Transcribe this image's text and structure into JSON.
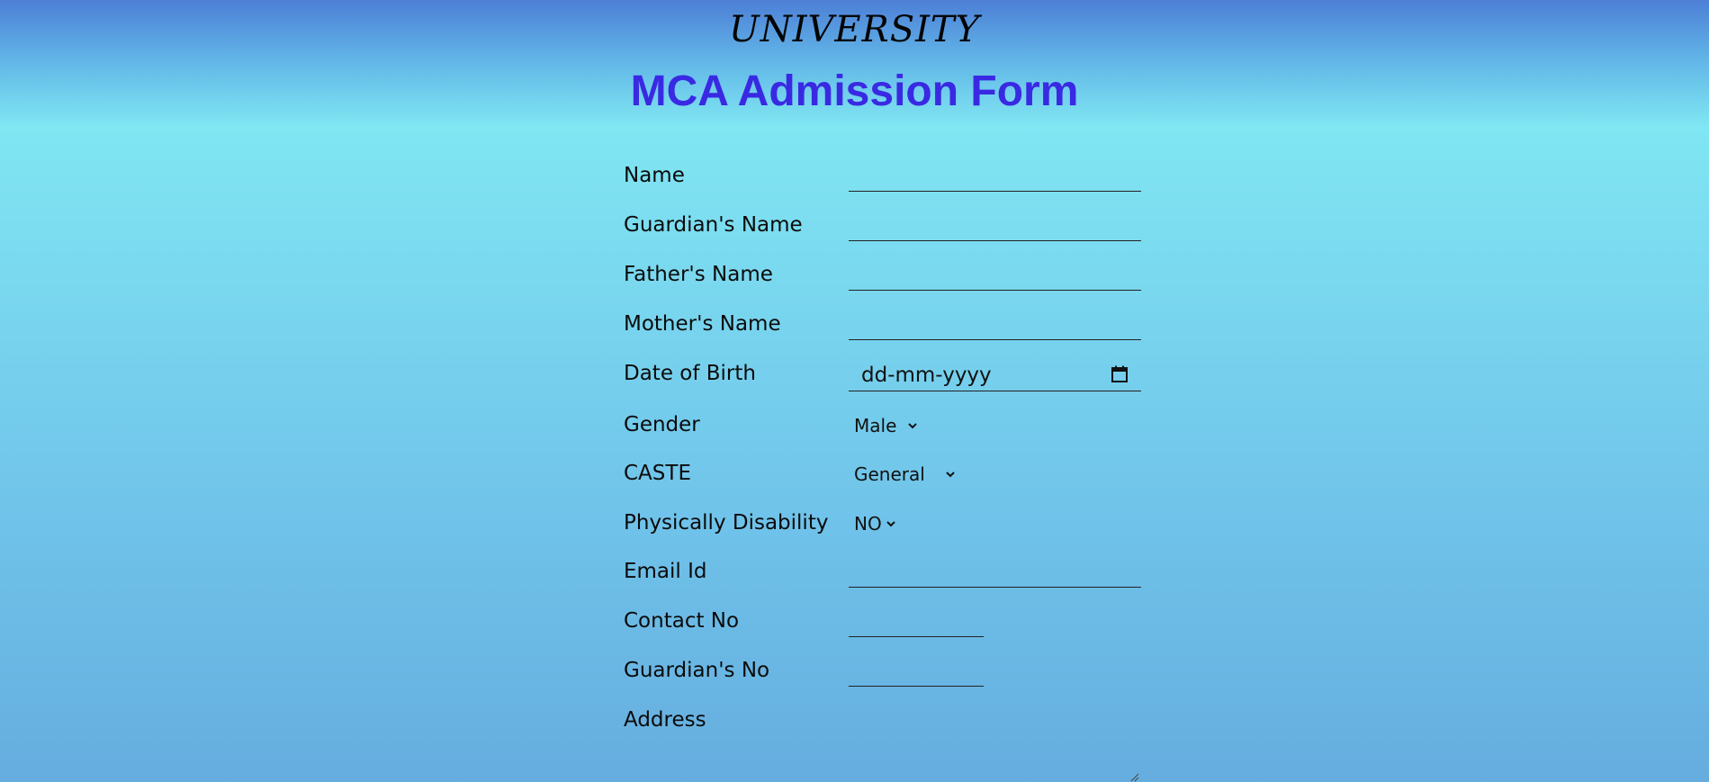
{
  "header": {
    "university": "UNIVERSITY",
    "form_title": "MCA Admission Form"
  },
  "form": {
    "name": {
      "label": "Name",
      "value": ""
    },
    "guardian_name": {
      "label": "Guardian's Name",
      "value": ""
    },
    "father_name": {
      "label": "Father's Name",
      "value": ""
    },
    "mother_name": {
      "label": "Mother's Name",
      "value": ""
    },
    "dob": {
      "label": "Date of Birth",
      "placeholder": "dd-mm-yyyy",
      "icon": "calendar-icon"
    },
    "gender": {
      "label": "Gender",
      "selected": "Male"
    },
    "caste": {
      "label": "CASTE",
      "selected": "General"
    },
    "disability": {
      "label": "Physically Disability",
      "selected": "NO"
    },
    "email": {
      "label": "Email Id",
      "value": ""
    },
    "contact": {
      "label": "Contact No",
      "value": ""
    },
    "guardian_no": {
      "label": "Guardian's No",
      "value": ""
    },
    "address": {
      "label": "Address",
      "value": ""
    }
  },
  "colors": {
    "title": "#3a29e3",
    "background_top": "#4d7fd6",
    "background_mid": "#80e6f2",
    "background_bottom": "#65addf"
  }
}
